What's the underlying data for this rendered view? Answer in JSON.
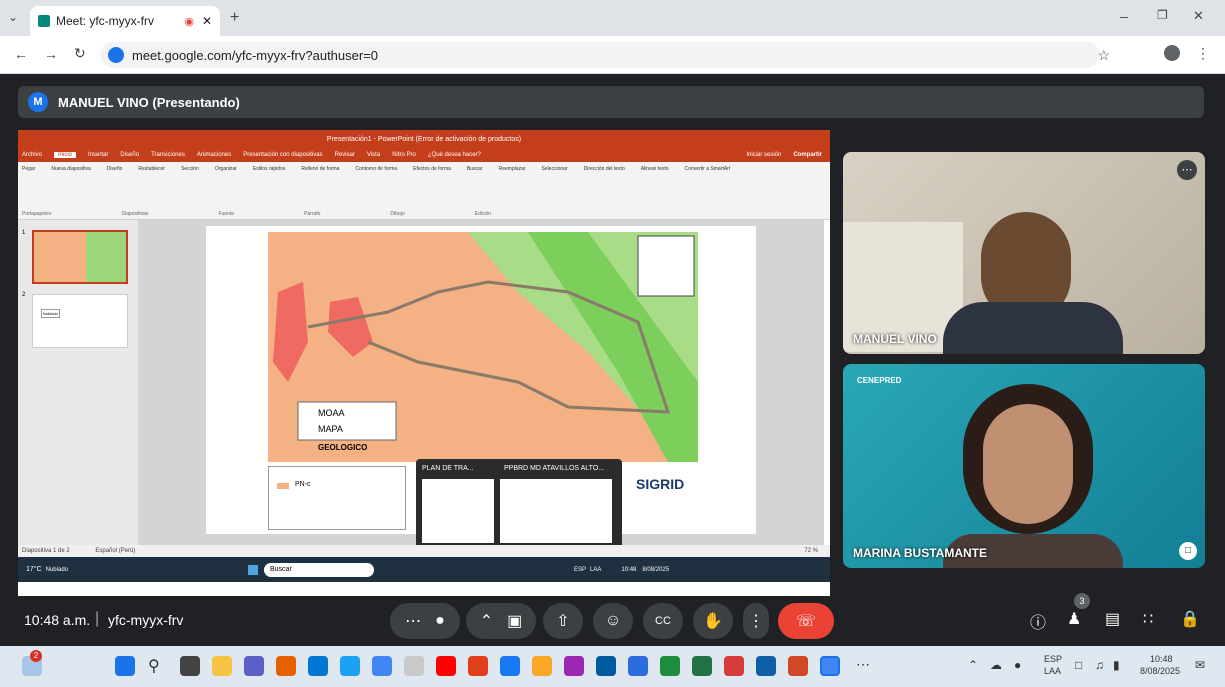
{
  "browser": {
    "tab_title": "Meet: yfc-myyx-frv",
    "url": "meet.google.com/yfc-myyx-frv?authuser=0"
  },
  "meet": {
    "presenter_initial": "M",
    "presenter_label": "MANUEL VINO (Presentando)",
    "time": "10:48 a.m.",
    "meeting_code": "yfc-myyx-frv",
    "participants_count": "3",
    "participants": [
      {
        "name": "MANUEL VINO"
      },
      {
        "name": "MARINA BUSTAMANTE"
      }
    ]
  },
  "powerpoint": {
    "title": "Presentación1 - PowerPoint (Error de activación de productos)",
    "tabs": [
      "Archivo",
      "Inicio",
      "Insertar",
      "Diseño",
      "Transiciones",
      "Animaciones",
      "Presentación con diapositivas",
      "Revisar",
      "Vista",
      "Nitro Pro",
      "¿Qué desea hacer?"
    ],
    "ribbon_groups": [
      "Portapapeles",
      "Diapositivas",
      "Fuente",
      "Párrafo",
      "Dibujo",
      "Edición"
    ],
    "ribbon_items": [
      "Pegar",
      "Nueva diapositiva",
      "Diseño",
      "Restablecer",
      "Sección",
      "Organizar",
      "Estilos rápidos",
      "Relleno de forma",
      "Contorno de forma",
      "Efectos de forma",
      "Buscar",
      "Reemplazar",
      "Seleccionar",
      "Dirección del texto",
      "Alinear texto",
      "Convertir a SmartArt"
    ],
    "signin": "Iniciar sesión",
    "share": "Compartir",
    "status": "Diapositiva 1 de 2",
    "language": "Español (Perú)",
    "zoom": "72 %",
    "slide_numbers": [
      "1",
      "2"
    ],
    "slide2_text": "Nublado",
    "map_labels": {
      "moaa": "MOAA",
      "mapa": "MAPA",
      "geologico": "GEOLOGICO",
      "legend_item": "PN-c",
      "sigrid": "SIGRID"
    },
    "popups": [
      {
        "title": "PLAN DE TRA..."
      },
      {
        "title": "PPBRD MD ATAVILLOS ALTO..."
      }
    ],
    "inner_taskbar": {
      "weather": "17°C",
      "weather_desc": "Nublado",
      "search": "Buscar",
      "lang": "ESP",
      "lang2": "LAA",
      "time": "10:48",
      "date": "8/08/2025"
    }
  },
  "tile_badge": "CENEPRED",
  "taskbar": {
    "lang": "ESP",
    "lang2": "LAA",
    "time": "10:48",
    "date": "8/08/2025",
    "notification_count": "2"
  },
  "colors": {
    "meet_bg": "#202124",
    "end_call": "#ea4335",
    "ppt_red": "#c43e1c",
    "map_orange": "#f4b183",
    "map_green": "#7ccf5a",
    "tile_teal": "#1aa3b8"
  }
}
